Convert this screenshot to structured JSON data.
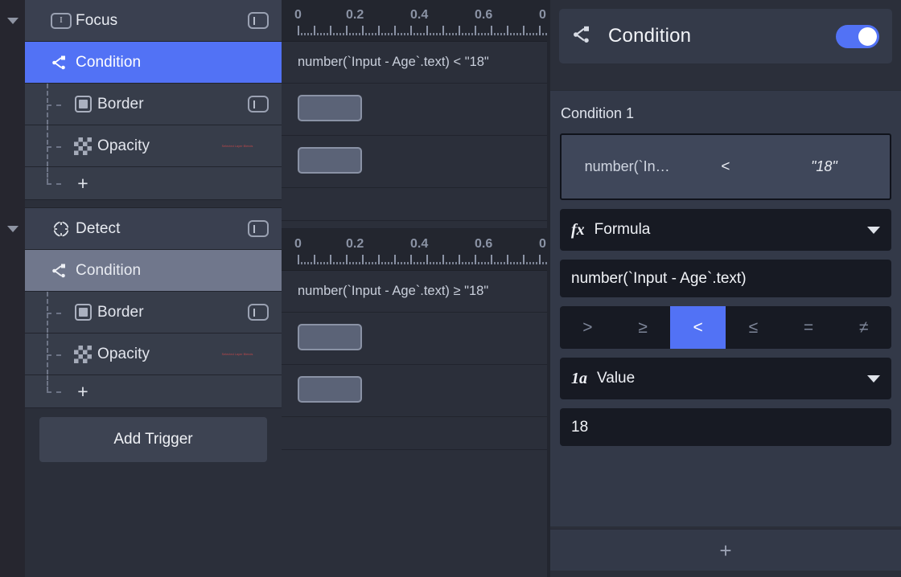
{
  "outliner": {
    "groups": [
      {
        "name": "Focus",
        "icon": "text-cursor-icon",
        "toggle_icon": "toggle-off-icon",
        "expanded_caret": "caret-down-icon",
        "children": [
          {
            "name": "Condition",
            "icon": "branch-icon",
            "selected": "blue"
          },
          {
            "name": "Border",
            "icon": "square-filled-icon",
            "toggle_icon": "toggle-off-icon"
          },
          {
            "name": "Opacity",
            "icon": "checkerboard-icon",
            "note": "Selected Layer Blends"
          }
        ],
        "add_label": "+"
      },
      {
        "name": "Detect",
        "icon": "crosshair-icon",
        "toggle_icon": "toggle-off-icon",
        "expanded_caret": "caret-down-icon",
        "children": [
          {
            "name": "Condition",
            "icon": "branch-icon",
            "selected": "gray"
          },
          {
            "name": "Border",
            "icon": "square-filled-icon",
            "toggle_icon": "toggle-off-icon"
          },
          {
            "name": "Opacity",
            "icon": "checkerboard-icon",
            "note": "Selected Layer Blends"
          }
        ],
        "add_label": "+"
      }
    ],
    "add_trigger_label": "Add Trigger"
  },
  "timeline": {
    "ruler_ticks": [
      "0",
      "0.2",
      "0.4",
      "0.6",
      "0"
    ],
    "tracks": [
      {
        "expression": "number(`Input - Age`.text) < \"18\""
      },
      {
        "expression": "number(`Input - Age`.text) ≥ \"18\""
      }
    ]
  },
  "inspector": {
    "header": {
      "title": "Condition",
      "icon": "branch-icon",
      "toggle_on": true
    },
    "section_label": "Condition 1",
    "summary": {
      "left": "number(`In…",
      "operator": "<",
      "right": "\"18\""
    },
    "source_type": {
      "glyph": "fx",
      "label": "Formula",
      "caret": "chevron-down-icon"
    },
    "formula_value": "number(`Input - Age`.text)",
    "operators": [
      {
        "symbol": ">",
        "active": false
      },
      {
        "symbol": "≥",
        "active": false
      },
      {
        "symbol": "<",
        "active": true
      },
      {
        "symbol": "≤",
        "active": false
      },
      {
        "symbol": "=",
        "active": false
      },
      {
        "symbol": "≠",
        "active": false
      }
    ],
    "value_type": {
      "glyph": "1a",
      "label": "Value",
      "caret": "chevron-down-icon"
    },
    "value": "18",
    "add_condition_label": "+"
  },
  "colors": {
    "accent_blue": "#5272f5",
    "panel_bg": "#2b2f3a",
    "row_bg": "#373d4a",
    "group_bg": "#3a4050",
    "field_dark": "#171a23",
    "gray_select": "#70778c"
  }
}
